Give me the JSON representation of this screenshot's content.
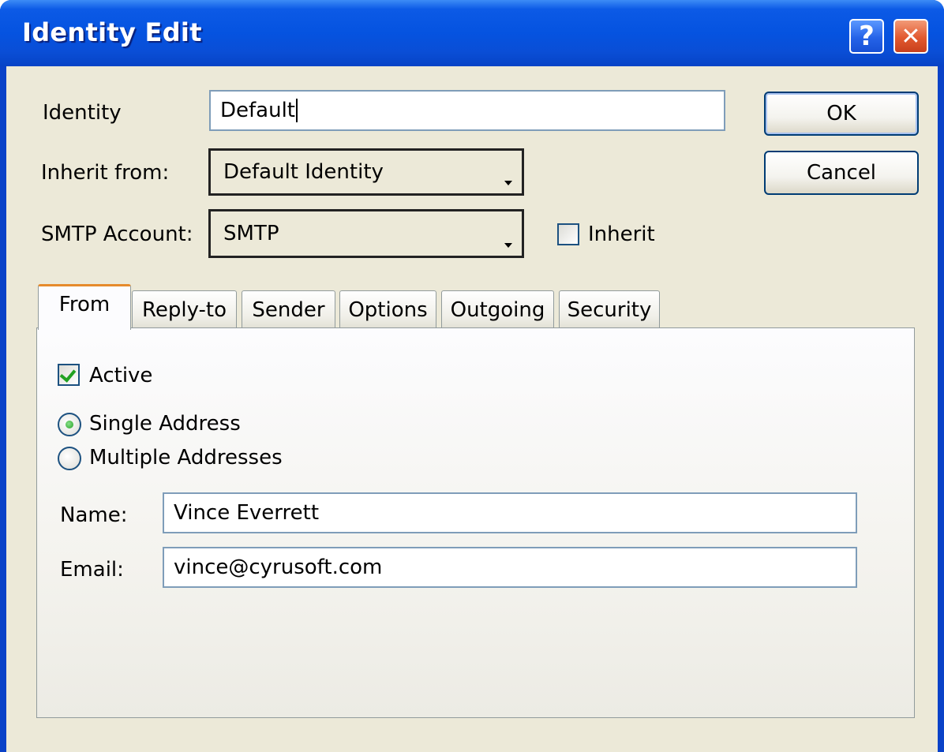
{
  "window": {
    "title": "Identity Edit",
    "help_symbol": "?",
    "close_symbol": "✕"
  },
  "form": {
    "identity_label": "Identity",
    "identity_value": "Default",
    "inherit_label": "Inherit from:",
    "inherit_value": "Default Identity",
    "smtp_label": "SMTP Account:",
    "smtp_value": "SMTP",
    "smtp_inherit_label": "Inherit",
    "smtp_inherit_checked": false
  },
  "buttons": {
    "ok": "OK",
    "cancel": "Cancel"
  },
  "tabs": [
    {
      "label": "From",
      "active": true
    },
    {
      "label": "Reply-to",
      "active": false
    },
    {
      "label": "Sender",
      "active": false
    },
    {
      "label": "Options",
      "active": false
    },
    {
      "label": "Outgoing",
      "active": false
    },
    {
      "label": "Security",
      "active": false
    }
  ],
  "from_tab": {
    "active_label": "Active",
    "active_checked": true,
    "single_label": "Single Address",
    "multiple_label": "Multiple Addresses",
    "selected_mode": "Single Address",
    "name_label": "Name:",
    "name_value": "Vince Everrett",
    "email_label": "Email:",
    "email_value": "vince@cyrusoft.com"
  },
  "icons": {
    "help": "help-icon",
    "close": "close-icon",
    "dropdown": "chevron-down-icon",
    "checkmark": "checkmark-icon"
  }
}
